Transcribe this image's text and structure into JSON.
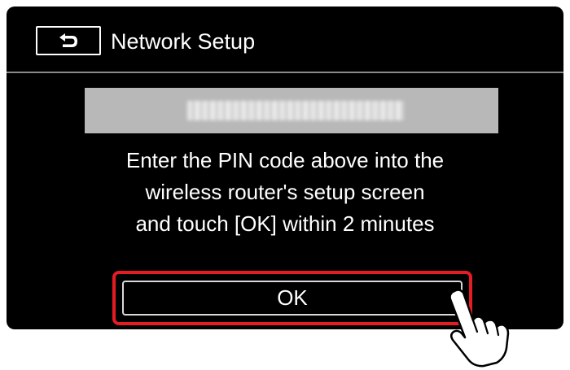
{
  "header": {
    "back_icon": "return-arrow-icon",
    "title": "Network Setup"
  },
  "pin": {
    "value": "",
    "obscured": true
  },
  "instructions": {
    "line1": "Enter the PIN code above into the",
    "line2": "wireless router's setup screen",
    "line3": "and touch [OK] within 2 minutes"
  },
  "ok_button": {
    "label": "OK",
    "highlight_color": "#e51c24"
  },
  "pointer": {
    "icon": "hand-pointer-icon"
  },
  "colors": {
    "screen_background": "#000000",
    "text": "#ffffff",
    "pin_bar": "#b8b8b8"
  }
}
